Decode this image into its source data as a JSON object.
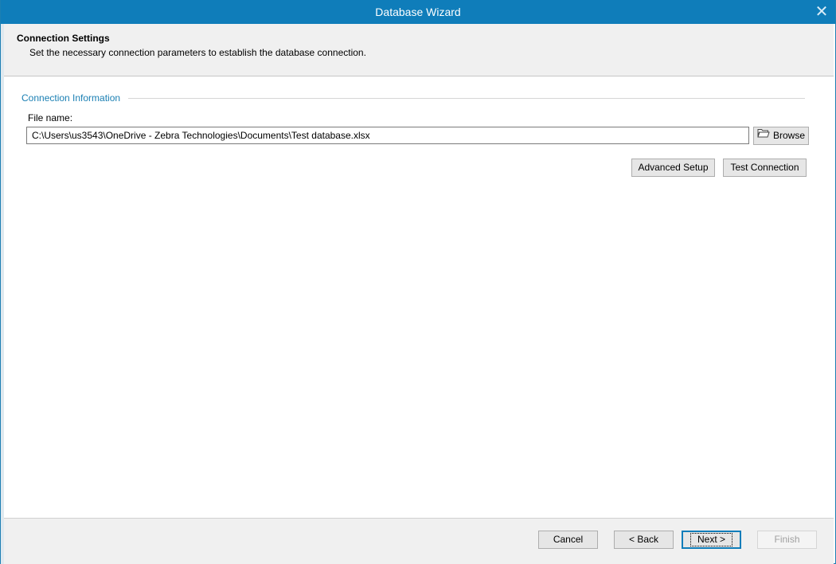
{
  "window": {
    "title": "Database Wizard",
    "close_icon": "close-icon"
  },
  "header": {
    "title": "Connection Settings",
    "description": "Set the necessary connection parameters to establish the database connection."
  },
  "section": {
    "title": "Connection Information"
  },
  "file": {
    "label": "File name:",
    "value": "C:\\Users\\us3543\\OneDrive - Zebra Technologies\\Documents\\Test database.xlsx",
    "browse_label": "Browse",
    "browse_icon": "folder-icon"
  },
  "actions": {
    "advanced_setup": "Advanced Setup",
    "test_connection": "Test Connection"
  },
  "footer": {
    "cancel": "Cancel",
    "back": "< Back",
    "next": "Next >",
    "finish": "Finish"
  },
  "colors": {
    "titlebar": "#0f7dba",
    "section_title": "#1a7fb3"
  }
}
